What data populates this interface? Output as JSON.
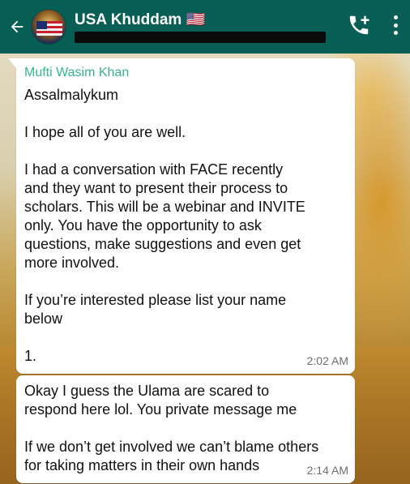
{
  "header": {
    "back_icon": "arrow-left-icon",
    "group_name": "USA Khuddam 🇺🇸",
    "subtitle": "",
    "call_icon": "add-call-icon",
    "menu_icon": "more-vertical-icon",
    "bar_color": "#075e54"
  },
  "messages": [
    {
      "sender": "Mufti Wasim Khan",
      "lines": [
        "Assalmalykum",
        "",
        "I hope all of you are well.",
        "",
        "I had a conversation with FACE recently",
        "and they want to present their process to",
        "scholars. This will be a webinar and INVITE",
        "only. You have the opportunity to ask",
        "questions, make suggestions and even get",
        "more involved.",
        "",
        "If you’re interested please list your name",
        "below",
        "",
        "1."
      ],
      "time": "2:02 AM"
    },
    {
      "lines": [
        "Okay I guess the Ulama are scared to",
        "respond here lol. You private message me",
        "",
        "If we don’t get involved we can’t blame others",
        "for taking matters in their own hands"
      ],
      "time": "2:14 AM"
    }
  ],
  "colors": {
    "sender_name": "#35b58d",
    "bubble": "#ffffff",
    "timestamp": "#6e6e6e"
  }
}
